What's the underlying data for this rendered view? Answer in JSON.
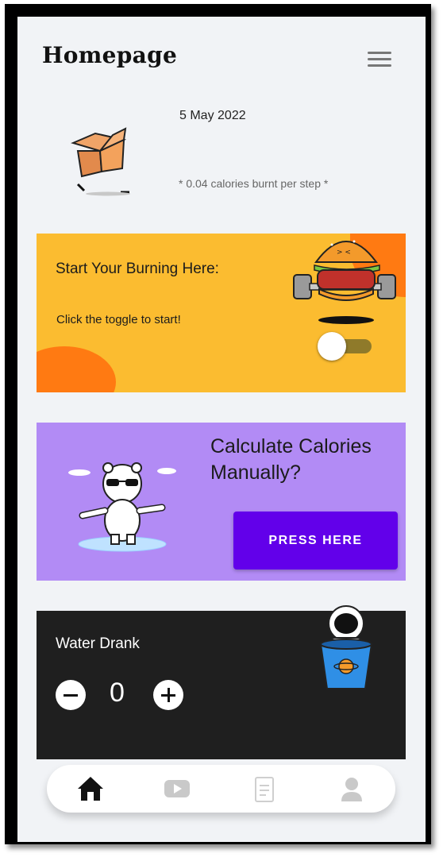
{
  "header": {
    "title": "Homepage",
    "menu_icon": "hamburger-menu-icon"
  },
  "info": {
    "date": "5 May 2022",
    "calories_note": "* 0.04 calories burnt per step *"
  },
  "burn_card": {
    "title": "Start Your Burning Here:",
    "subtitle": "Click the toggle to start!",
    "toggle_on": false,
    "background": "#fbbc30",
    "accent": "#ff7a12"
  },
  "calc_card": {
    "title_line1": "Calculate Calories",
    "title_line2": "Manually?",
    "button_label": "PRESS HERE",
    "background": "#b28bf5",
    "button_color": "#6200ea"
  },
  "water_card": {
    "title": "Water Drank",
    "count": "0",
    "background": "#1f1f1f"
  },
  "bottom_nav": {
    "items": [
      {
        "name": "home",
        "icon": "home-icon",
        "active": true
      },
      {
        "name": "videos",
        "icon": "video-play-icon",
        "active": false
      },
      {
        "name": "notes",
        "icon": "notepad-icon",
        "active": false
      },
      {
        "name": "profile",
        "icon": "user-profile-icon",
        "active": false
      }
    ]
  }
}
